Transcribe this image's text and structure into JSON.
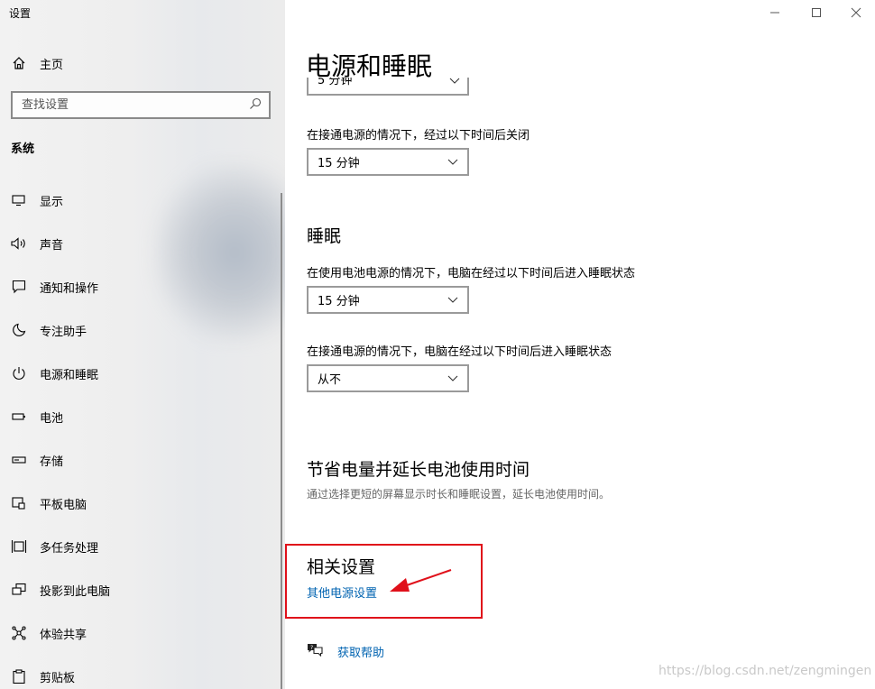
{
  "app": {
    "title": "设置"
  },
  "sidebar": {
    "home_label": "主页",
    "search_placeholder": "查找设置",
    "section": "系统",
    "items": [
      {
        "label": "显示",
        "icon": "monitor-icon"
      },
      {
        "label": "声音",
        "icon": "speaker-icon"
      },
      {
        "label": "通知和操作",
        "icon": "notification-icon"
      },
      {
        "label": "专注助手",
        "icon": "moon-icon"
      },
      {
        "label": "电源和睡眠",
        "icon": "power-icon"
      },
      {
        "label": "电池",
        "icon": "battery-icon"
      },
      {
        "label": "存储",
        "icon": "storage-icon"
      },
      {
        "label": "平板电脑",
        "icon": "tablet-icon"
      },
      {
        "label": "多任务处理",
        "icon": "multitask-icon"
      },
      {
        "label": "投影到此电脑",
        "icon": "project-icon"
      },
      {
        "label": "体验共享",
        "icon": "share-icon"
      },
      {
        "label": "剪贴板",
        "icon": "clipboard-icon"
      }
    ]
  },
  "main": {
    "title": "电源和睡眠",
    "screen": {
      "top_select_value": "5 分钟",
      "plugged_label": "在接通电源的情况下，经过以下时间后关闭",
      "plugged_value": "15 分钟"
    },
    "sleep": {
      "title": "睡眠",
      "battery_label": "在使用电池电源的情况下，电脑在经过以下时间后进入睡眠状态",
      "battery_value": "15 分钟",
      "plugged_label": "在接通电源的情况下，电脑在经过以下时间后进入睡眠状态",
      "plugged_value": "从不"
    },
    "save_energy": {
      "title": "节省电量并延长电池使用时间",
      "desc": "通过选择更短的屏幕显示时长和睡眠设置，延长电池使用时间。"
    },
    "related": {
      "title": "相关设置",
      "link": "其他电源设置"
    },
    "help_link": "获取帮助"
  },
  "annotation_color": "#e0101a",
  "watermark": "https://blog.csdn.net/zengmingen"
}
